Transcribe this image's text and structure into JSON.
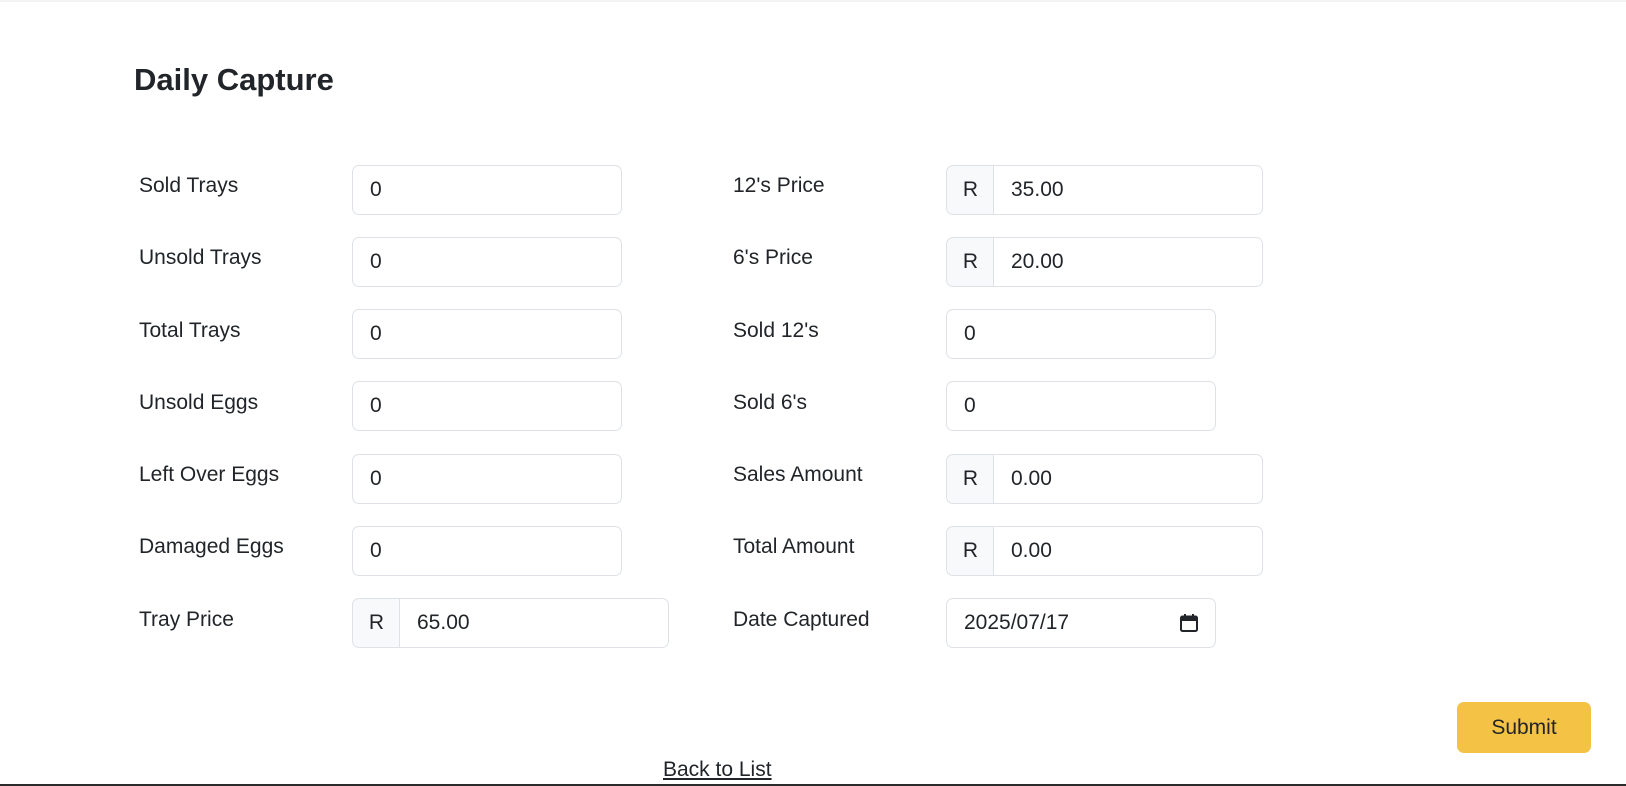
{
  "page": {
    "title": "Daily Capture"
  },
  "currency_symbol": "R",
  "fields": {
    "sold_trays": {
      "label": "Sold Trays",
      "value": "0"
    },
    "unsold_trays": {
      "label": "Unsold Trays",
      "value": "0"
    },
    "total_trays": {
      "label": "Total Trays",
      "value": "0"
    },
    "unsold_eggs": {
      "label": "Unsold Eggs",
      "value": "0"
    },
    "left_over_eggs": {
      "label": "Left Over Eggs",
      "value": "0"
    },
    "damaged_eggs": {
      "label": "Damaged Eggs",
      "value": "0"
    },
    "tray_price": {
      "label": "Tray Price",
      "value": "65.00"
    },
    "price_12s": {
      "label": "12's Price",
      "value": "35.00"
    },
    "price_6s": {
      "label": "6's Price",
      "value": "20.00"
    },
    "sold_12s": {
      "label": "Sold 12's",
      "value": "0"
    },
    "sold_6s": {
      "label": "Sold 6's",
      "value": "0"
    },
    "sales_amount": {
      "label": "Sales Amount",
      "value": "0.00"
    },
    "total_amount": {
      "label": "Total Amount",
      "value": "0.00"
    },
    "date_captured": {
      "label": "Date Captured",
      "value": "2025/07/17"
    }
  },
  "actions": {
    "submit_label": "Submit",
    "back_label": "Back to List"
  },
  "colors": {
    "submit_bg": "#f4c345",
    "addon_bg": "#f8f9fa",
    "border": "#dee2e6"
  },
  "icons": {
    "date_picker": "calendar-icon"
  }
}
